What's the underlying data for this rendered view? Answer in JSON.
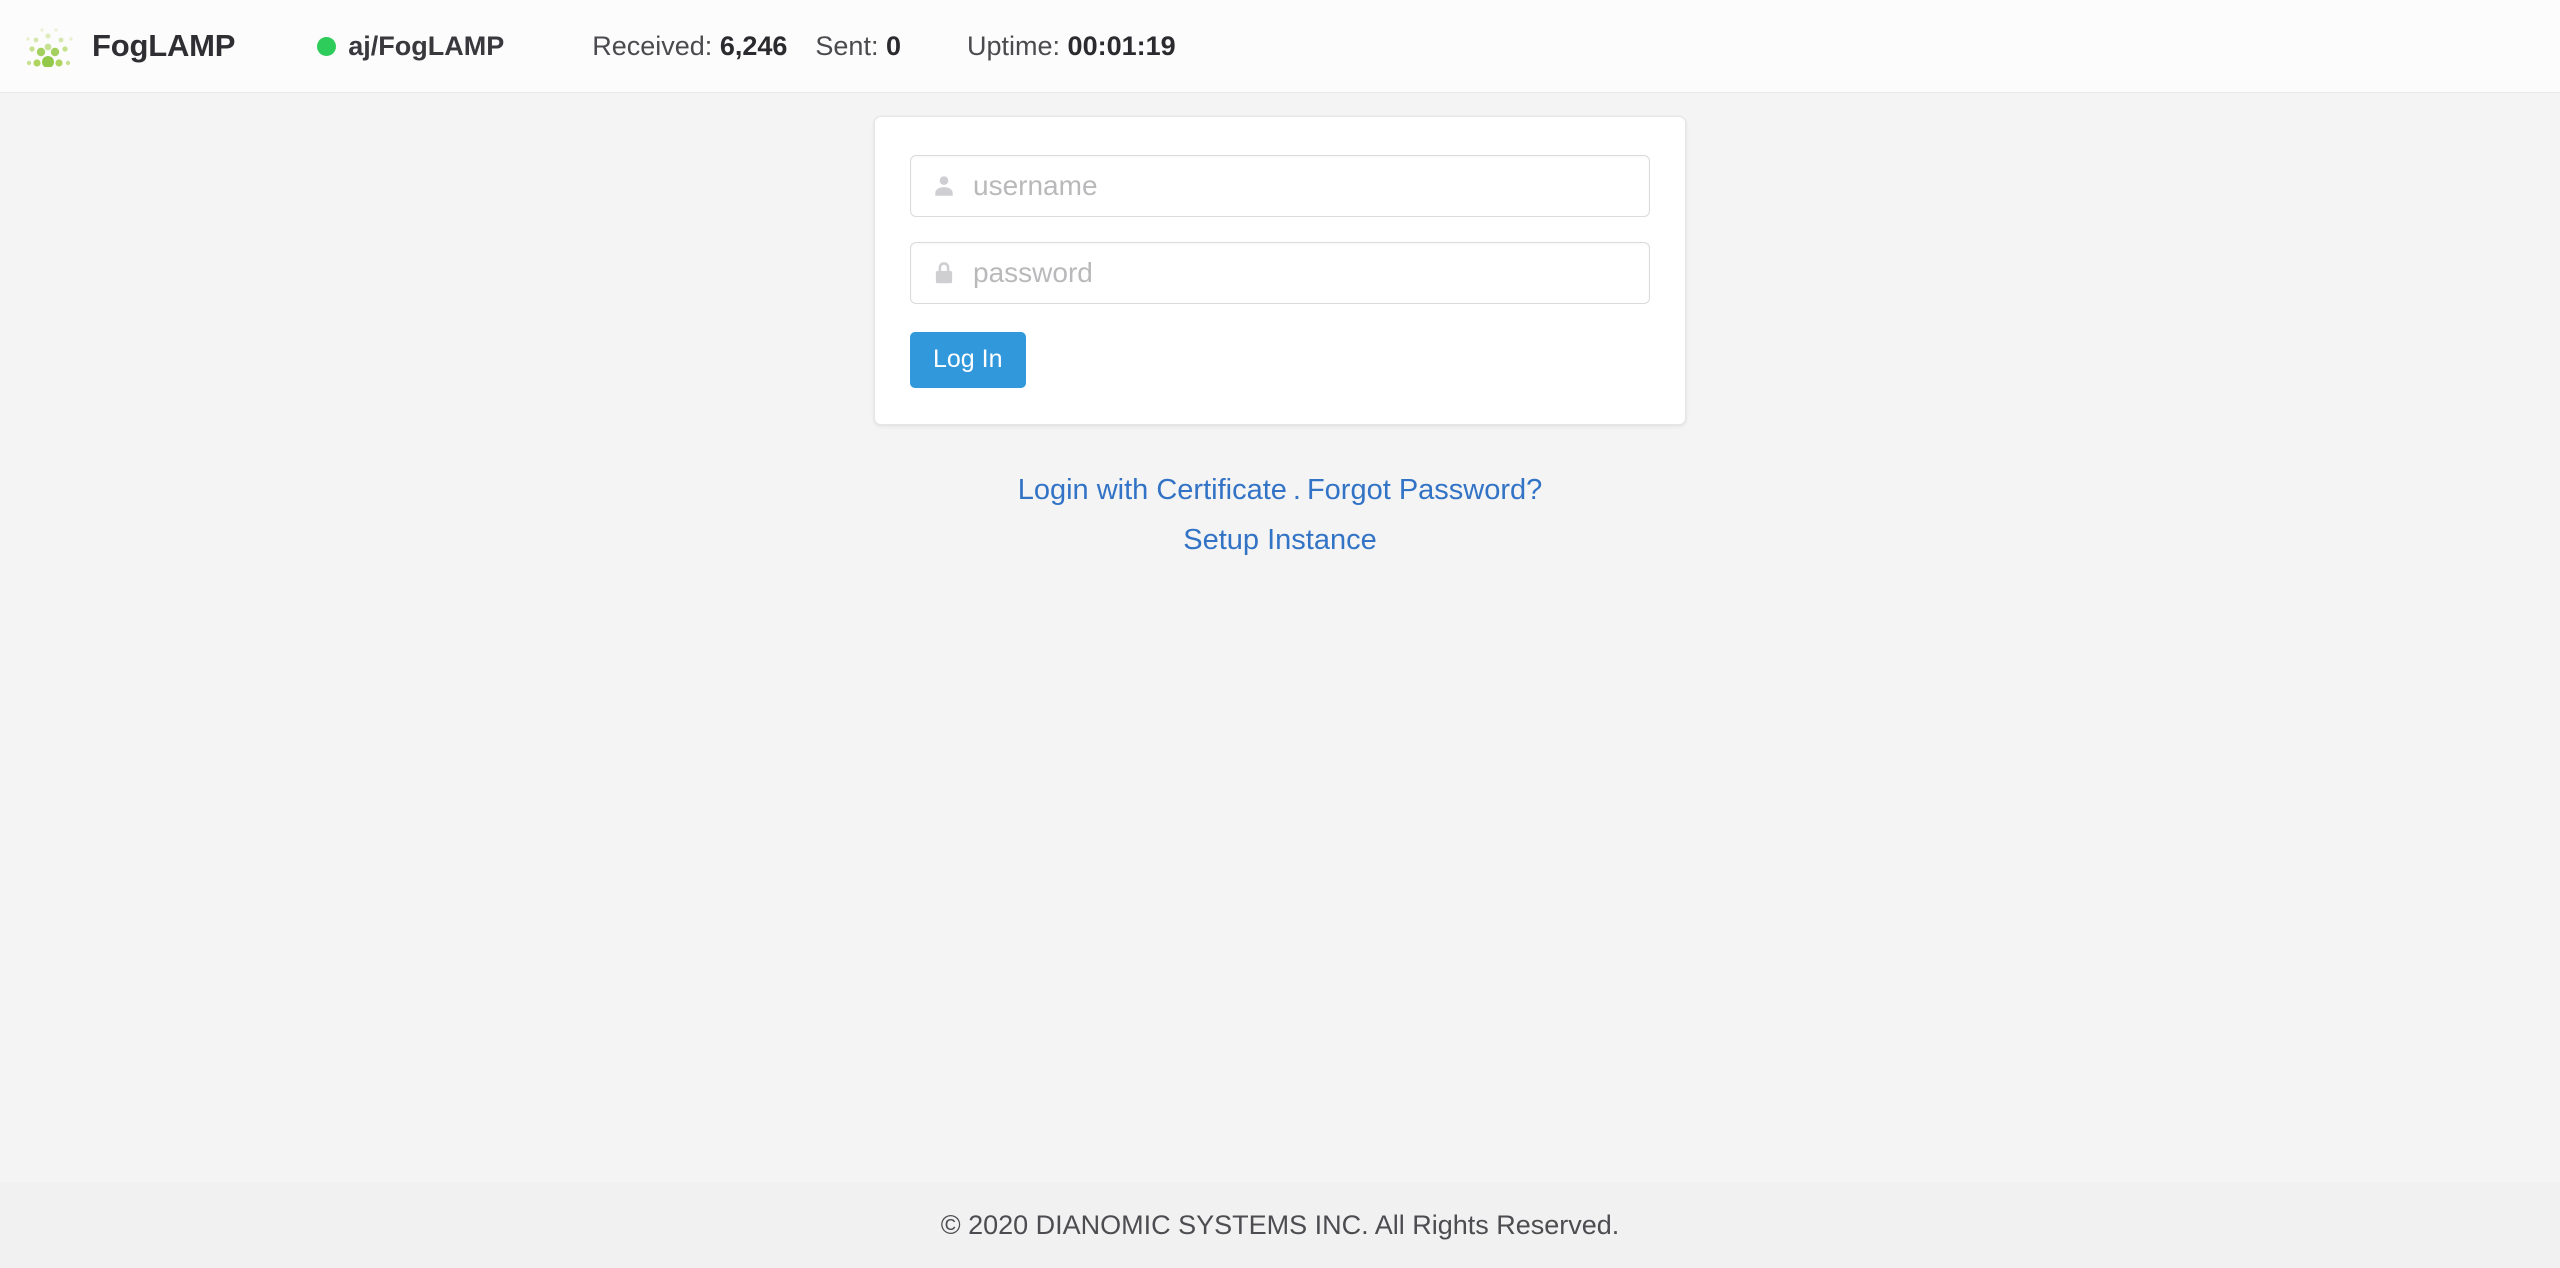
{
  "navbar": {
    "brand": {
      "logo_icon": "foglamp-dots-logo",
      "name": "FogLAMP"
    },
    "instance": {
      "status_icon": "status-dot-green",
      "status_color": "#2ecc5a",
      "label": "aj/FogLAMP"
    },
    "stats": [
      {
        "label": "Received:",
        "value": "6,246"
      },
      {
        "label": "Sent:",
        "value": "0"
      },
      {
        "label": "Uptime:",
        "value": "00:01:19"
      }
    ]
  },
  "login": {
    "username": {
      "icon": "user-icon",
      "placeholder": "username",
      "value": ""
    },
    "password": {
      "icon": "lock-icon",
      "placeholder": "password",
      "value": ""
    },
    "submit_label": "Log In",
    "submit_color": "#3298dc"
  },
  "links": {
    "certificate": "Login with Certificate",
    "separator": ".",
    "forgot_password": "Forgot Password?",
    "setup_instance": "Setup Instance",
    "link_color": "#3273c6"
  },
  "footer": {
    "copyright": "© 2020 DIANOMIC SYSTEMS INC. All Rights Reserved."
  }
}
